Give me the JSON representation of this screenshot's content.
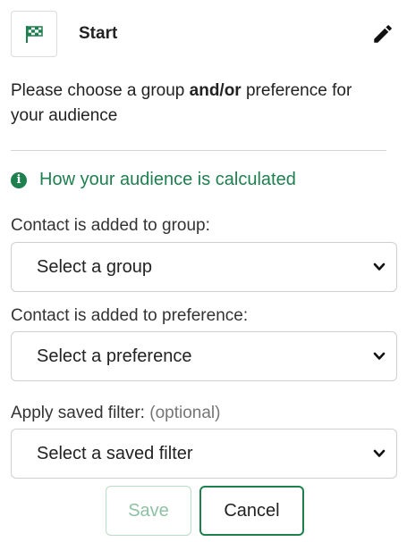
{
  "header": {
    "title": "Start",
    "step_icon": "checkered-flag-icon",
    "edit_icon": "pencil-icon"
  },
  "instructions": {
    "prefix": "Please choose a group ",
    "emphasis": "and/or",
    "suffix": " preference for your audience"
  },
  "info": {
    "icon": "info-circle-icon",
    "label": "How your audience is calculated"
  },
  "fields": {
    "group": {
      "label": "Contact is added to group:",
      "selected": "Select a group"
    },
    "preference": {
      "label": "Contact is added to preference:",
      "selected": "Select a preference"
    },
    "filter": {
      "label": "Apply saved filter:",
      "optional": "(optional)",
      "selected": "Select a saved filter"
    }
  },
  "actions": {
    "save_label": "Save",
    "cancel_label": "Cancel"
  },
  "colors": {
    "accent": "#1e7f4f",
    "disabled_text": "#8fc1a4",
    "disabled_border": "#b9dcc8"
  }
}
